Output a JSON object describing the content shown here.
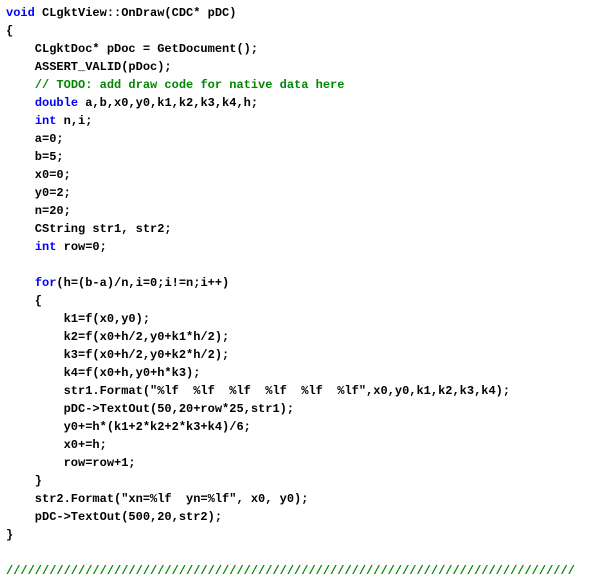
{
  "code": {
    "l1": {
      "kw": "void",
      "rest": " CLgktView::OnDraw(CDC* pDC)"
    },
    "l2": "{",
    "l3": "    CLgktDoc* pDoc = GetDocument();",
    "l4": "    ASSERT_VALID(pDoc);",
    "l5": {
      "indent": "    ",
      "com": "// TODO: add draw code for native data here"
    },
    "l6": {
      "indent": "    ",
      "kw": "double",
      "rest": " a,b,x0,y0,k1,k2,k3,k4,h;"
    },
    "l7": {
      "indent": "    ",
      "kw": "int",
      "rest": " n,i;"
    },
    "l8": "    a=0;",
    "l9": "    b=5;",
    "l10": "    x0=0;",
    "l11": "    y0=2;",
    "l12": "    n=20;",
    "l13": "    CString str1, str2;",
    "l14": {
      "indent": "    ",
      "kw": "int",
      "rest": " row=0;"
    },
    "blank": "",
    "l15": {
      "indent": "    ",
      "kw": "for",
      "rest": "(h=(b-a)/n,i=0;i!=n;i++)"
    },
    "l16": "    {",
    "l17": "        k1=f(x0,y0);",
    "l18": "        k2=f(x0+h/2,y0+k1*h/2);",
    "l19": "        k3=f(x0+h/2,y0+k2*h/2);",
    "l20": "        k4=f(x0+h,y0+h*k3);",
    "l21": "        str1.Format(\"%lf  %lf  %lf  %lf  %lf  %lf\",x0,y0,k1,k2,k3,k4);",
    "l22": "        pDC->TextOut(50,20+row*25,str1);",
    "l23": "        y0+=h*(k1+2*k2+2*k3+k4)/6;",
    "l24": "        x0+=h;",
    "l25": "        row=row+1;",
    "l26": "    }",
    "l27": "    str2.Format(\"xn=%lf  yn=%lf\", x0, y0);",
    "l28": "    pDC->TextOut(500,20,str2);",
    "l29": "}",
    "divider": "///////////////////////////////////////////////////////////////////////////////"
  }
}
